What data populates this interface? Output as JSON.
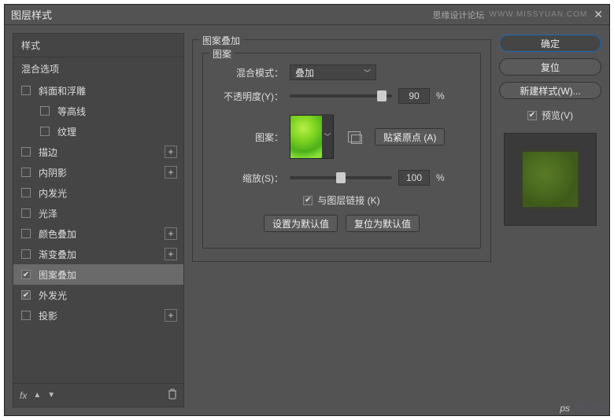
{
  "title": "图层样式",
  "credit": "思缘设计论坛",
  "url": "WWW.MISSYUAN.COM",
  "sidebar": {
    "header": "样式",
    "sub": "混合选项",
    "items": [
      {
        "label": "斜面和浮雕",
        "checked": false,
        "plus": false,
        "indent": false
      },
      {
        "label": "等高线",
        "checked": false,
        "plus": false,
        "indent": true
      },
      {
        "label": "纹理",
        "checked": false,
        "plus": false,
        "indent": true
      },
      {
        "label": "描边",
        "checked": false,
        "plus": true,
        "indent": false
      },
      {
        "label": "内阴影",
        "checked": false,
        "plus": true,
        "indent": false
      },
      {
        "label": "内发光",
        "checked": false,
        "plus": false,
        "indent": false
      },
      {
        "label": "光泽",
        "checked": false,
        "plus": false,
        "indent": false
      },
      {
        "label": "颜色叠加",
        "checked": false,
        "plus": true,
        "indent": false
      },
      {
        "label": "渐变叠加",
        "checked": false,
        "plus": true,
        "indent": false
      },
      {
        "label": "图案叠加",
        "checked": true,
        "plus": false,
        "indent": false,
        "selected": true
      },
      {
        "label": "外发光",
        "checked": true,
        "plus": false,
        "indent": false
      },
      {
        "label": "投影",
        "checked": false,
        "plus": true,
        "indent": false
      }
    ],
    "fx": "fx"
  },
  "panel": {
    "title": "图案叠加",
    "group": "图案",
    "blend_label": "混合模式：",
    "blend_value": "叠加",
    "opacity_label": "不透明度(Y)：",
    "opacity_value": "90",
    "opacity_pct": 90,
    "percent": "%",
    "pattern_label": "图案：",
    "snap_label": "贴紧原点 (A)",
    "scale_label": "缩放(S)：",
    "scale_value": "100",
    "scale_pct": 50,
    "link_label": "与图层链接 (K)",
    "set_default": "设置为默认值",
    "reset_default": "复位为默认值"
  },
  "right": {
    "ok": "确定",
    "reset": "复位",
    "new_style": "新建样式(W)...",
    "preview": "预览(V)"
  },
  "watermark": {
    "ps": "ps",
    "cn": "爱好者"
  }
}
